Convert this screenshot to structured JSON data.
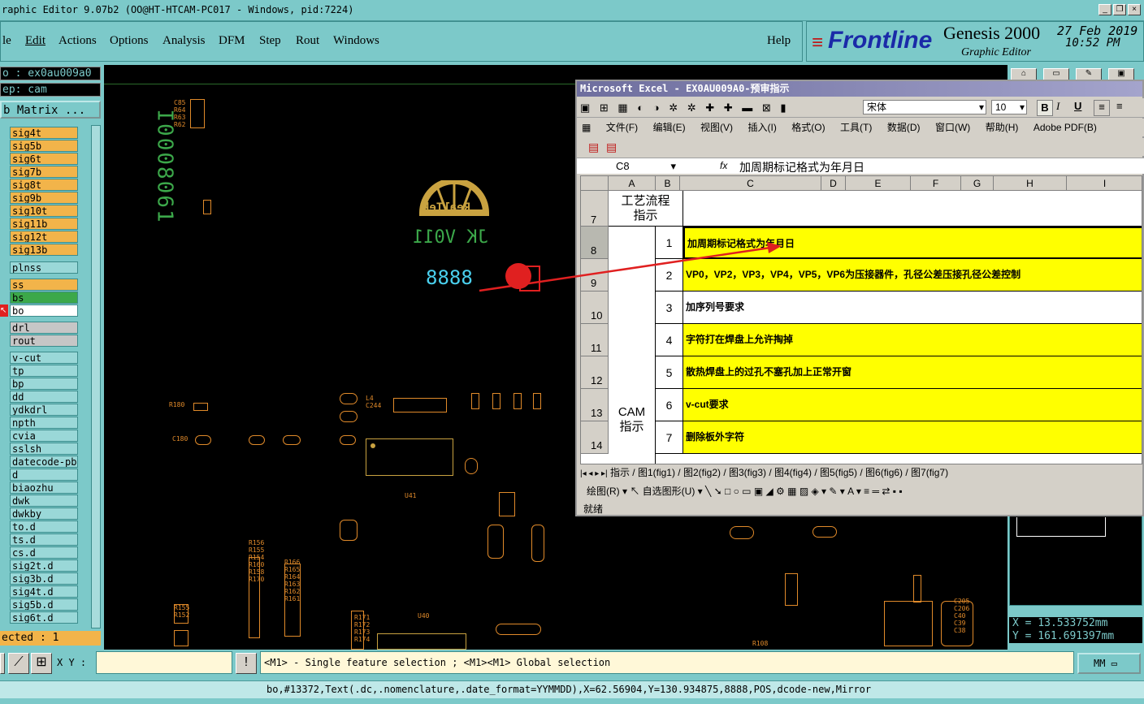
{
  "genesis": {
    "title": "raphic Editor 9.07b2 (OO@HT-HTCAM-PC017 - Windows, pid:7224)",
    "menu": [
      "le",
      "Edit",
      "Actions",
      "Options",
      "Analysis",
      "DFM",
      "Step",
      "Rout",
      "Windows"
    ],
    "help": "Help",
    "brand": "Frontline",
    "product": "Genesis 2000",
    "subtitle": "Graphic Editor",
    "date": "27 Feb 2019",
    "time": "10:52 PM",
    "job": "o : ex0au009a0",
    "step": "ep: cam",
    "matrix": "b Matrix ...",
    "layers_top": [
      "sig4t",
      "sig5b",
      "sig6t",
      "sig7b",
      "sig8t",
      "sig9b",
      "sig10t",
      "sig11b",
      "sig12t",
      "sig13b"
    ],
    "plnss": "plnss",
    "layers_mid": [
      "ss",
      "bs",
      "bo"
    ],
    "layers_drl": [
      "drl",
      "rout"
    ],
    "layers_bot": [
      "v-cut",
      "tp",
      "bp",
      "dd",
      "ydkdrl",
      "npth",
      "cvia",
      "sslsh",
      "datecode-pbe",
      "d",
      "biaozhu",
      "dwk",
      "dwkby",
      "to.d",
      "ts.d",
      "cs.d",
      "sig2t.d",
      "sig3b.d",
      "sig4t.d",
      "sig5b.d",
      "sig6t.d"
    ],
    "selected": "ected : 1",
    "xy_label": "X Y :",
    "hint": "<M1> - Single feature selection ; <M1><M1> Global selection",
    "units": "MM",
    "coord_x": "X  =  13.533752mm",
    "coord_y": "Y  =  161.691397mm",
    "status": "bo,#13372,Text(.dc,.nomenclature,.date_format=YYMMDD),X=62.56904,Y=130.934875,8888,POS,dcode-new,Mirror",
    "board_texts": {
      "vert": "I0008061",
      "logo": "RealTek",
      "jk": "JK V011",
      "num": "8888"
    }
  },
  "excel": {
    "title": "Microsoft Excel - EX0AU009A0-预审指示",
    "font": "宋体",
    "size": "10",
    "menu": [
      "文件(F)",
      "编辑(E)",
      "视图(V)",
      "插入(I)",
      "格式(O)",
      "工具(T)",
      "数据(D)",
      "窗口(W)",
      "帮助(H)",
      "Adobe PDF(B)"
    ],
    "cellref": "C8",
    "fx": "fx",
    "formula": "加周期标记格式为年月日",
    "cols": [
      "A",
      "B",
      "C",
      "D",
      "E",
      "F",
      "G",
      "H",
      "I"
    ],
    "row7": {
      "num": "7",
      "a": "工艺流程\n指示"
    },
    "group": "CAM\n指示",
    "rows": [
      {
        "num": "8",
        "idx": "1",
        "text": "加周期标记格式为年月日",
        "yellow": true
      },
      {
        "num": "9",
        "idx": "2",
        "text": "VP0，VP2，VP3，VP4，VP5，VP6为压接器件，孔径公差压接孔径公差控制",
        "yellow": true
      },
      {
        "num": "10",
        "idx": "3",
        "text": "加序列号要求",
        "yellow": false
      },
      {
        "num": "11",
        "idx": "4",
        "text": "字符打在焊盘上允许掏掉",
        "yellow": true
      },
      {
        "num": "12",
        "idx": "5",
        "text": "散热焊盘上的过孔不塞孔加上正常开窗",
        "yellow": true
      },
      {
        "num": "13",
        "idx": "6",
        "text": "v-cut要求",
        "yellow": true
      },
      {
        "num": "14",
        "idx": "7",
        "text": "删除板外字符",
        "yellow": true
      }
    ],
    "sheets": "指示 / 图1(fig1) / 图2(fig2) / 图3(fig3) / 图4(fig4) / 图5(fig5) / 图6(fig6) / 图7(fig7)",
    "draw": "绘图(R) ▾  ↖  自选图形(U) ▾  ╲  ➘  □  ○  ▭  ▣  ◢  ⚙  ▦  ▨   ◈ ▾  ✎ ▾  A ▾  ≡  ═  ⇄  ▪  ▪",
    "ready": "就绪"
  },
  "colors": {
    "accent": "#7cc9c9",
    "yellow": "#ffff00",
    "layer_orange": "#f2b44a",
    "arrow": "#e02020"
  }
}
